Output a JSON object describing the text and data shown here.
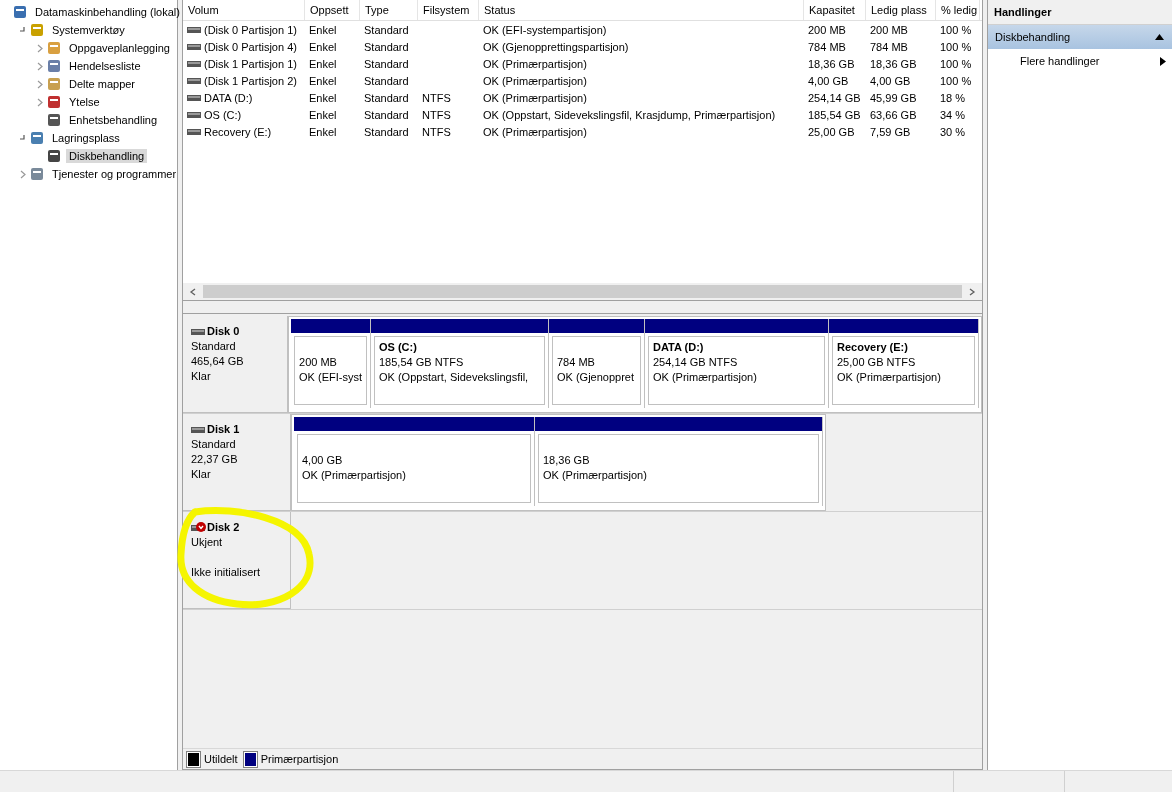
{
  "tree": [
    {
      "label": "Datamaskinbehandling (lokal)",
      "selected": false,
      "children": [
        {
          "label": "Systemverktøy",
          "expanded": true,
          "selected": false,
          "children": [
            {
              "label": "Oppgaveplanlegging",
              "expanded": false,
              "selected": false
            },
            {
              "label": "Hendelsesliste",
              "expanded": false,
              "selected": false
            },
            {
              "label": "Delte mapper",
              "expanded": false,
              "selected": false
            },
            {
              "label": "Ytelse",
              "expanded": false,
              "selected": false
            },
            {
              "label": "Enhetsbehandling",
              "selected": false
            }
          ]
        },
        {
          "label": "Lagringsplass",
          "expanded": true,
          "selected": false,
          "children": [
            {
              "label": "Diskbehandling",
              "selected": true
            }
          ]
        },
        {
          "label": "Tjenester og programmer",
          "expanded": false,
          "selected": false
        }
      ]
    }
  ],
  "table": {
    "columns": [
      "Volum",
      "Oppsett",
      "Type",
      "Filsystem",
      "Status",
      "Kapasitet",
      "Ledig plass",
      "% ledig"
    ],
    "rows": [
      [
        "(Disk 0 Partisjon 1)",
        "Enkel",
        "Standard",
        "",
        "OK (EFI-systempartisjon)",
        "200 MB",
        "200 MB",
        "100 %"
      ],
      [
        "(Disk 0 Partisjon 4)",
        "Enkel",
        "Standard",
        "",
        "OK (Gjenopprettingspartisjon)",
        "784 MB",
        "784 MB",
        "100 %"
      ],
      [
        "(Disk 1 Partisjon 1)",
        "Enkel",
        "Standard",
        "",
        "OK (Primærpartisjon)",
        "18,36 GB",
        "18,36 GB",
        "100 %"
      ],
      [
        "(Disk 1 Partisjon 2)",
        "Enkel",
        "Standard",
        "",
        "OK (Primærpartisjon)",
        "4,00 GB",
        "4,00 GB",
        "100 %"
      ],
      [
        "DATA (D:)",
        "Enkel",
        "Standard",
        "NTFS",
        "OK (Primærpartisjon)",
        "254,14 GB",
        "45,99 GB",
        "18 %"
      ],
      [
        "OS (C:)",
        "Enkel",
        "Standard",
        "NTFS",
        "OK (Oppstart, Sidevekslingsfil, Krasjdump, Primærpartisjon)",
        "185,54 GB",
        "63,66 GB",
        "34 %"
      ],
      [
        "Recovery (E:)",
        "Enkel",
        "Standard",
        "NTFS",
        "OK (Primærpartisjon)",
        "25,00 GB",
        "7,59 GB",
        "30 %"
      ]
    ]
  },
  "disks": [
    {
      "name": "Disk 0",
      "type": "Standard",
      "size": "465,64 GB",
      "state": "Klar",
      "error": false,
      "partitions": [
        {
          "size": "200 MB",
          "status": "OK (EFI-syst"
        },
        {
          "name": "OS  (C:)",
          "size": "185,54 GB NTFS",
          "status": "OK (Oppstart, Sidevekslingsfil,"
        },
        {
          "size": "784 MB",
          "status": "OK (Gjenoppret"
        },
        {
          "name": "DATA  (D:)",
          "size": "254,14 GB NTFS",
          "status": "OK (Primærpartisjon)"
        },
        {
          "name": "Recovery  (E:)",
          "size": "25,00 GB NTFS",
          "status": "OK (Primærpartisjon)"
        }
      ]
    },
    {
      "name": "Disk 1",
      "type": "Standard",
      "size": "22,37 GB",
      "state": "Klar",
      "error": false,
      "partitions": [
        {
          "size": "4,00 GB",
          "status": "OK (Primærpartisjon)"
        },
        {
          "size": "18,36 GB",
          "status": "OK (Primærpartisjon)"
        }
      ]
    },
    {
      "name": "Disk 2",
      "type": "Ukjent",
      "state": "Ikke initialisert",
      "error": true
    }
  ],
  "legend": [
    {
      "label": "Utildelt",
      "color": "#000000"
    },
    {
      "label": "Primærpartisjon",
      "color": "#000080"
    }
  ],
  "actions": {
    "title": "Handlinger",
    "section": {
      "label": "Diskbehandling",
      "expanded": true
    },
    "items": [
      "Flere handlinger"
    ]
  }
}
